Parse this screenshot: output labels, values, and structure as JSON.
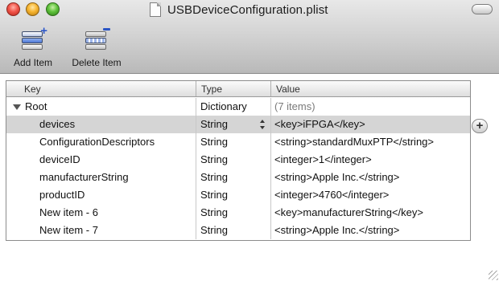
{
  "window": {
    "title": "USBDeviceConfiguration.plist"
  },
  "toolbar": {
    "add_item_label": "Add Item",
    "delete_item_label": "Delete Item"
  },
  "table": {
    "columns": {
      "key": "Key",
      "type": "Type",
      "value": "Value"
    },
    "rows": [
      {
        "key": "Root",
        "type": "Dictionary",
        "value": "(7 items)"
      },
      {
        "key": "devices",
        "type": "String",
        "value": "<key>iFPGA</key>"
      },
      {
        "key": "ConfigurationDescriptors",
        "type": "String",
        "value": "<string>standardMuxPTP</string>"
      },
      {
        "key": "deviceID",
        "type": "String",
        "value": "<integer>1</integer>"
      },
      {
        "key": "manufacturerString",
        "type": "String",
        "value": "<string>Apple Inc.</string>"
      },
      {
        "key": "productID",
        "type": "String",
        "value": "<integer>4760</integer>"
      },
      {
        "key": "New item - 6",
        "type": "String",
        "value": "<key>manufacturerString</key>"
      },
      {
        "key": "New item - 7",
        "type": "String",
        "value": "<string>Apple Inc.</string>"
      }
    ]
  },
  "add_row_button": "+",
  "icons": {
    "close": "close-button-icon",
    "minimize": "minimize-button-icon",
    "zoom": "zoom-button-icon",
    "document": "document-icon",
    "add_item": "add-item-icon",
    "delete_item": "delete-item-icon",
    "disclosure": "disclosure-triangle-icon",
    "stepper": "type-stepper-icon"
  },
  "colors": {
    "selected_row": "#d5d5d5",
    "toolbar_gradient_top": "#e8e8e8",
    "toolbar_gradient_bottom": "#b9b9b9"
  }
}
